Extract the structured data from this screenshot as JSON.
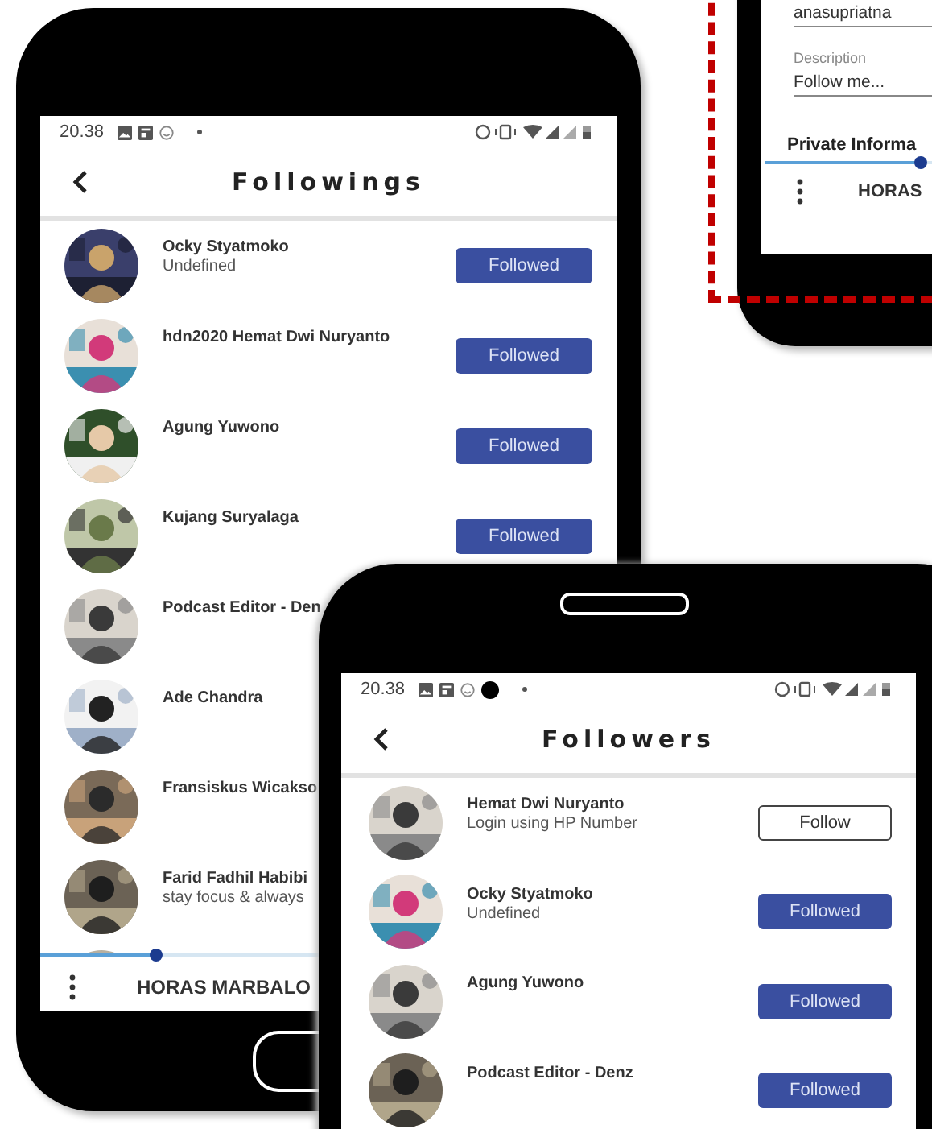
{
  "profile_screen": {
    "fields": [
      {
        "value": "anasupriatna"
      },
      {
        "label": "Description",
        "value": "Follow me..."
      }
    ],
    "section_heading": "Private Informa",
    "progress": {
      "level": 0.7
    },
    "bottom_bar": {
      "label": "HORAS"
    }
  },
  "followings_screen": {
    "time": "20.38",
    "title": "Followings",
    "rows": [
      {
        "name": "Ocky Styatmoko",
        "subtitle": "Undefined",
        "button": {
          "label": "Followed",
          "following": true
        }
      },
      {
        "name": "hdn2020 Hemat Dwi Nuryanto",
        "button": {
          "label": "Followed",
          "following": true
        }
      },
      {
        "name": "Agung Yuwono",
        "button": {
          "label": "Followed",
          "following": true
        }
      },
      {
        "name": "Kujang Suryalaga",
        "button": {
          "label": "Followed",
          "following": true
        }
      },
      {
        "name": "Podcast Editor - Den"
      },
      {
        "name": "Ade Chandra"
      },
      {
        "name": "Fransiskus Wicakso"
      },
      {
        "name": "Farid Fadhil Habibi",
        "subtitle": "stay focus & always"
      }
    ],
    "progress": {
      "level": 0.2
    },
    "bottom_bar": {
      "label": "HORAS MARBALO"
    }
  },
  "followers_screen": {
    "time": "20.38",
    "title": "Followers",
    "rows": [
      {
        "name": "Hemat Dwi Nuryanto",
        "subtitle": "Login using HP Number",
        "button": {
          "label": "Follow",
          "following": false
        }
      },
      {
        "name": "Ocky Styatmoko",
        "subtitle": "Undefined",
        "button": {
          "label": "Followed",
          "following": true
        }
      },
      {
        "name": "Agung Yuwono",
        "button": {
          "label": "Followed",
          "following": true
        }
      },
      {
        "name": "Podcast Editor - Denz",
        "button": {
          "label": "Followed",
          "following": true
        }
      }
    ]
  }
}
